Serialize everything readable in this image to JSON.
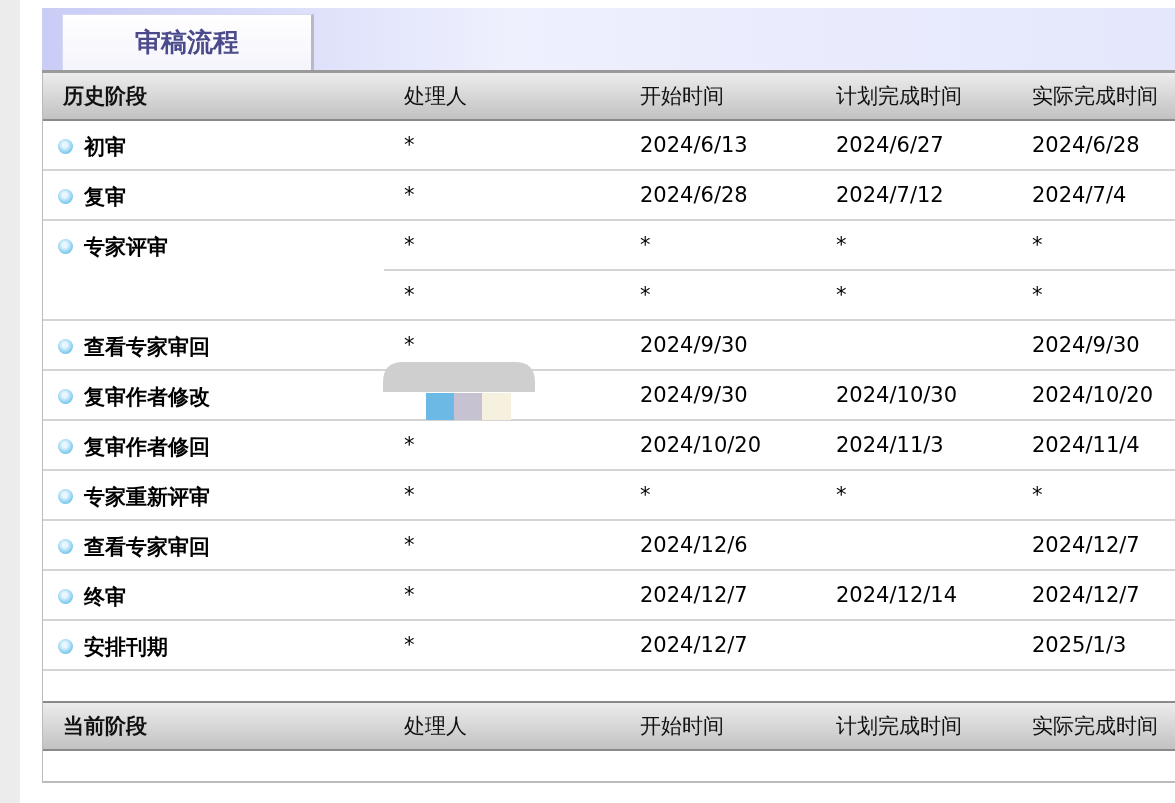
{
  "tab": {
    "label": "审稿流程",
    "selected": true
  },
  "history": {
    "columns": [
      "历史阶段",
      "处理人",
      "开始时间",
      "计划完成时间",
      "实际完成时间"
    ],
    "rows": [
      {
        "stage": "初审",
        "entries": [
          {
            "handler": "*",
            "start": "2024/6/13",
            "planned": "2024/6/27",
            "actual": "2024/6/28"
          }
        ]
      },
      {
        "stage": "复审",
        "entries": [
          {
            "handler": "*",
            "start": "2024/6/28",
            "planned": "2024/7/12",
            "actual": "2024/7/4"
          }
        ]
      },
      {
        "stage": "专家评审",
        "entries": [
          {
            "handler": "*",
            "start": "*",
            "planned": "*",
            "actual": "*"
          },
          {
            "handler": "*",
            "start": "*",
            "planned": "*",
            "actual": "*"
          }
        ]
      },
      {
        "stage": "查看专家审回",
        "entries": [
          {
            "handler": "*",
            "start": "2024/9/30",
            "actual": "2024/9/30"
          }
        ]
      },
      {
        "stage": "复审作者修改",
        "entries": [
          {
            "start": "2024/9/30",
            "planned": "2024/10/30",
            "actual": "2024/10/20"
          }
        ]
      },
      {
        "stage": "复审作者修回",
        "entries": [
          {
            "handler": "*",
            "start": "2024/10/20",
            "planned": "2024/11/3",
            "actual": "2024/11/4"
          }
        ]
      },
      {
        "stage": "专家重新评审",
        "entries": [
          {
            "handler": "*",
            "start": "*",
            "planned": "*",
            "actual": "*"
          }
        ]
      },
      {
        "stage": "查看专家审回",
        "entries": [
          {
            "handler": "*",
            "start": "2024/12/6",
            "actual": "2024/12/7"
          }
        ]
      },
      {
        "stage": "终审",
        "entries": [
          {
            "handler": "*",
            "start": "2024/12/7",
            "planned": "2024/12/14",
            "actual": "2024/12/7"
          }
        ]
      },
      {
        "stage": "安排刊期",
        "entries": [
          {
            "handler": "*",
            "start": "2024/12/7",
            "actual": "2025/1/3"
          }
        ]
      }
    ]
  },
  "current": {
    "columns": [
      "当前阶段",
      "处理人",
      "开始时间",
      "计划完成时间",
      "实际完成时间"
    ]
  }
}
